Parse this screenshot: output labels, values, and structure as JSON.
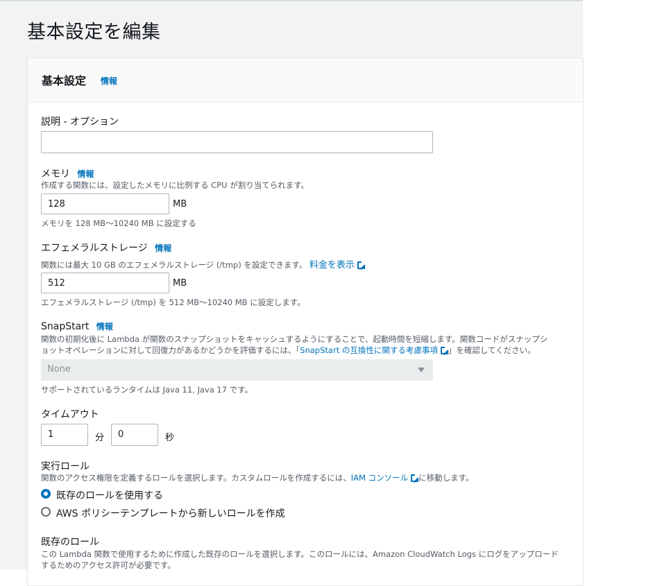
{
  "page": {
    "title": "基本設定を編集"
  },
  "panel": {
    "title": "基本設定",
    "info": "情報"
  },
  "description": {
    "label": "説明 - オプション",
    "value": ""
  },
  "memory": {
    "label": "メモリ",
    "info": "情報",
    "desc": "作成する関数には、設定したメモリに比例する CPU が割り当てられます。",
    "value": "128",
    "unit": "MB",
    "hint": "メモリを 128 MB〜10240 MB に設定する"
  },
  "ephemeral": {
    "label": "エフェメラルストレージ",
    "info": "情報",
    "desc": "関数には最大 10 GB のエフェメラルストレージ (/tmp) を設定できます。",
    "pricing_link": "料金を表示",
    "value": "512",
    "unit": "MB",
    "hint": "エフェメラルストレージ (/tmp) を 512 MB〜10240 MB に設定します。"
  },
  "snapstart": {
    "label": "SnapStart",
    "info": "情報",
    "desc_line1": "関数の初期化後に Lambda が関数のスナップショットをキャッシュするようにすることで、起動時間を短縮します。関数コードがスナップシ",
    "desc_line2_pre": "ョットオペレーションに対して回復力があるかどうかを評価するには、「",
    "desc_link": "SnapStart の互換性に関する考慮事項",
    "desc_line2_post": "」を確認してください。",
    "selected": "None",
    "hint": "サポートされているランタイムは Java 11, Java 17 です。"
  },
  "timeout": {
    "label": "タイムアウト",
    "minutes": "1",
    "minutes_unit": "分",
    "seconds": "0",
    "seconds_unit": "秒"
  },
  "role": {
    "label": "実行ロール",
    "desc_pre": "関数のアクセス権限を定義するロールを選択します。カスタムロールを作成するには、",
    "desc_link": "IAM コンソール",
    "desc_post": "に移動します。",
    "option_existing": "既存のロールを使用する",
    "option_new": "AWS ポリシーテンプレートから新しいロールを作成"
  },
  "existing_role": {
    "label": "既存のロール",
    "desc_line1": "この Lambda 関数で使用するために作成した既存のロールを選択します。このロールには、Amazon CloudWatch Logs にログをアップロード",
    "desc_line2": "するためのアクセス許可が必要です。"
  }
}
